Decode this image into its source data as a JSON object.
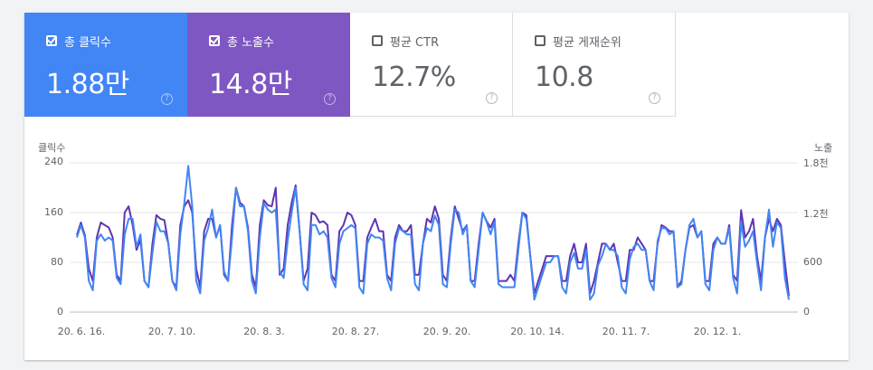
{
  "metrics": [
    {
      "label": "총 클릭수",
      "value": "1.88만",
      "checked": true,
      "color": "#4285f4"
    },
    {
      "label": "총 노출수",
      "value": "14.8만",
      "checked": true,
      "color": "#7e57c2"
    },
    {
      "label": "평균 CTR",
      "value": "12.7%",
      "checked": false,
      "color": "#ffffff"
    },
    {
      "label": "평균 게재순위",
      "value": "10.8",
      "checked": false,
      "color": "#ffffff"
    }
  ],
  "help_icon_glyph": "?",
  "chart_data": {
    "type": "line",
    "left_axis_title": "클릭수",
    "right_axis_title": "노출",
    "left_ticks": [
      "240",
      "160",
      "80",
      "0"
    ],
    "right_ticks": [
      "1.8천",
      "1.2천",
      "600",
      "0"
    ],
    "ylim_left": [
      0,
      240
    ],
    "ylim_right": [
      0,
      1800
    ],
    "x_ticks": [
      "20. 6. 16.",
      "20. 7. 10.",
      "20. 8. 3.",
      "20. 8. 27.",
      "20. 9. 20.",
      "20. 10. 14.",
      "20. 11. 7.",
      "20. 12. 1."
    ],
    "grid": true,
    "series": [
      {
        "color": "#4285f4",
        "axis": "left",
        "values": [
          120,
          140,
          120,
          50,
          35,
          115,
          125,
          115,
          120,
          115,
          55,
          45,
          125,
          150,
          150,
          105,
          125,
          50,
          40,
          95,
          145,
          130,
          130,
          110,
          50,
          35,
          125,
          175,
          235,
          170,
          50,
          30,
          115,
          135,
          165,
          120,
          140,
          65,
          50,
          120,
          200,
          170,
          170,
          130,
          50,
          30,
          120,
          175,
          165,
          160,
          165,
          65,
          55,
          115,
          160,
          200,
          130,
          45,
          35,
          140,
          140,
          125,
          130,
          120,
          55,
          40,
          110,
          130,
          135,
          140,
          135,
          40,
          30,
          110,
          125,
          120,
          120,
          115,
          55,
          35,
          110,
          135,
          130,
          125,
          125,
          45,
          35,
          110,
          135,
          130,
          155,
          140,
          45,
          40,
          110,
          165,
          160,
          125,
          140,
          50,
          40,
          100,
          160,
          145,
          125,
          145,
          45,
          40,
          40,
          40,
          40,
          100,
          160,
          150,
          90,
          20,
          40,
          60,
          80,
          80,
          90,
          90,
          40,
          30,
          80,
          95,
          70,
          70,
          100,
          20,
          30,
          75,
          90,
          110,
          100,
          100,
          90,
          40,
          30,
          85,
          105,
          110,
          100,
          100,
          50,
          35,
          115,
          135,
          135,
          125,
          130,
          40,
          45,
          100,
          140,
          150,
          120,
          130,
          45,
          35,
          100,
          120,
          110,
          110,
          135,
          55,
          30,
          145,
          105,
          115,
          130,
          80,
          35,
          120,
          165,
          105,
          145,
          135,
          55,
          20
        ]
      },
      {
        "color": "#5e35b1",
        "axis": "right",
        "values": [
          930,
          1080,
          930,
          525,
          375,
          900,
          1080,
          1050,
          1020,
          900,
          450,
          375,
          1200,
          1275,
          1050,
          750,
          870,
          375,
          300,
          825,
          1170,
          1125,
          1110,
          825,
          375,
          300,
          1050,
          1275,
          1350,
          1200,
          525,
          300,
          975,
          1125,
          1125,
          900,
          1050,
          450,
          375,
          1050,
          1500,
          1320,
          1275,
          1020,
          450,
          300,
          1050,
          1350,
          1290,
          1275,
          1500,
          450,
          525,
          1050,
          1320,
          1530,
          975,
          375,
          525,
          1200,
          1170,
          1080,
          1095,
          1050,
          450,
          375,
          975,
          1050,
          1200,
          1170,
          1050,
          375,
          375,
          900,
          1020,
          1125,
          975,
          975,
          450,
          375,
          900,
          1050,
          975,
          975,
          1050,
          450,
          450,
          825,
          1125,
          1080,
          1275,
          1125,
          450,
          375,
          900,
          1275,
          1125,
          975,
          1050,
          375,
          375,
          825,
          1200,
          1095,
          1020,
          1125,
          375,
          375,
          375,
          450,
          375,
          825,
          1200,
          1170,
          675,
          225,
          375,
          525,
          675,
          675,
          675,
          675,
          375,
          375,
          675,
          825,
          600,
          600,
          825,
          225,
          375,
          600,
          825,
          825,
          750,
          825,
          600,
          375,
          375,
          750,
          750,
          900,
          825,
          750,
          375,
          375,
          825,
          1050,
          1020,
          975,
          975,
          300,
          375,
          750,
          1020,
          1050,
          900,
          975,
          375,
          375,
          825,
          900,
          825,
          825,
          1050,
          450,
          375,
          1230,
          900,
          975,
          1125,
          675,
          375,
          900,
          1125,
          975,
          1125,
          1050,
          600,
          195
        ]
      }
    ]
  }
}
